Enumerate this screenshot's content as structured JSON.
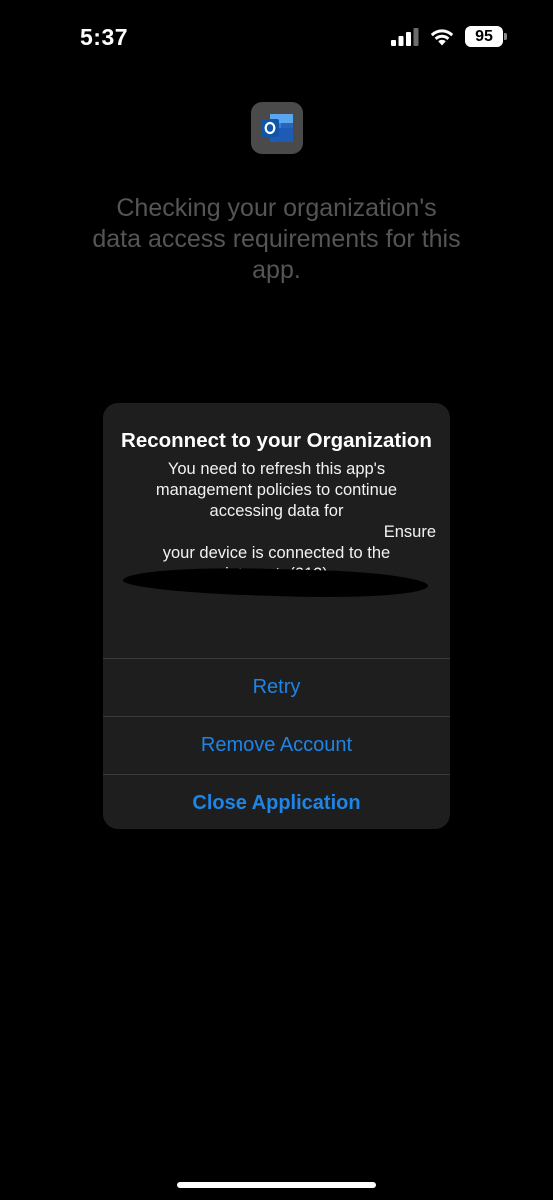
{
  "status_bar": {
    "time": "5:37",
    "battery_level": "95",
    "icons": [
      "signal-icon",
      "wifi-icon",
      "battery-icon"
    ]
  },
  "app": {
    "icon": "outlook-icon",
    "checking_message": "Checking your organization's data access requirements for this app."
  },
  "alert": {
    "title": "Reconnect to your Organization",
    "message_line1": "You need to refresh this app's management policies to continue accessing data for",
    "message_line2": "Ensure",
    "message_line3": "your device is connected to the internet. (212)",
    "actions": {
      "retry": "Retry",
      "remove_account": "Remove Account",
      "close_application": "Close Application"
    }
  },
  "colors": {
    "background": "#000000",
    "alert_background": "#1e1e1e",
    "action_blue": "#1e84e6",
    "muted_text": "#555555"
  }
}
